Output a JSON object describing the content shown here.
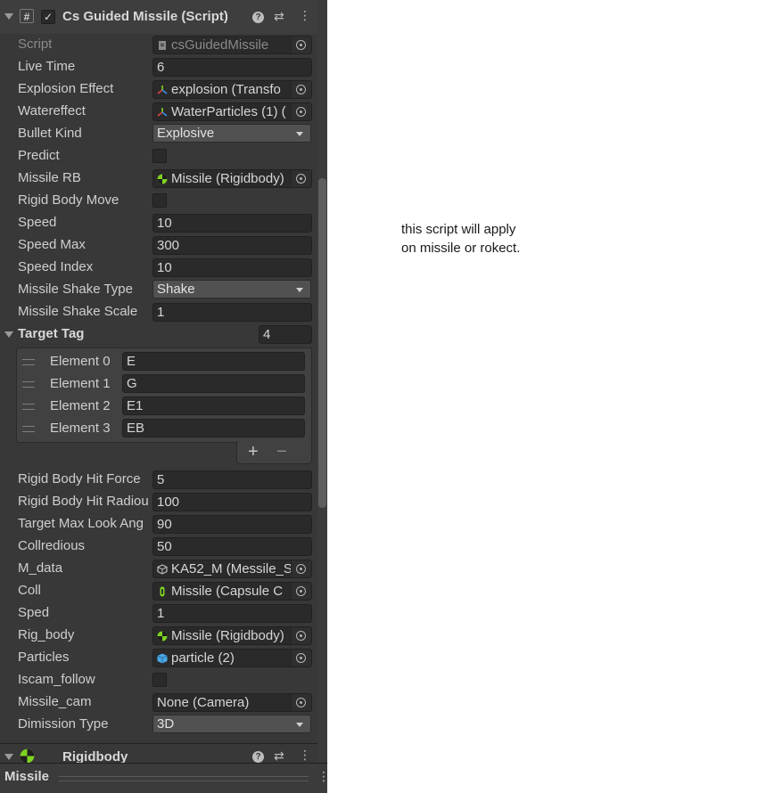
{
  "component": {
    "title": "Cs Guided Missile (Script)",
    "enabled": true
  },
  "fields": {
    "script": {
      "label": "Script",
      "value": "csGuidedMissile"
    },
    "live_time": {
      "label": "Live Time",
      "value": "6"
    },
    "explosion_effect": {
      "label": "Explosion Effect",
      "value": "explosion (Transfo"
    },
    "watereffect": {
      "label": "Watereffect",
      "value": "WaterParticles (1) ("
    },
    "bullet_kind": {
      "label": "Bullet Kind",
      "value": "Explosive"
    },
    "predict": {
      "label": "Predict",
      "checked": false
    },
    "missile_rb": {
      "label": "Missile RB",
      "value": "Missile (Rigidbody)"
    },
    "rigid_body_move": {
      "label": "Rigid Body Move",
      "checked": false
    },
    "speed": {
      "label": "Speed",
      "value": "10"
    },
    "speed_max": {
      "label": "Speed Max",
      "value": "300"
    },
    "speed_index": {
      "label": "Speed Index",
      "value": "10"
    },
    "missile_shake_type": {
      "label": "Missile Shake Type",
      "value": "Shake"
    },
    "missile_shake_scale": {
      "label": "Missile Shake Scale",
      "value": "1"
    },
    "rigid_body_hit_force": {
      "label": "Rigid Body Hit Force",
      "value": "5"
    },
    "rigid_body_hit_radius": {
      "label": "Rigid Body Hit Radiou",
      "value": "100"
    },
    "target_max_look_angle": {
      "label": "Target Max Look Ang",
      "value": "90"
    },
    "collredious": {
      "label": "Collredious",
      "value": "50"
    },
    "m_data": {
      "label": "M_data",
      "value": "KA52_M (Messile_S"
    },
    "coll": {
      "label": "Coll",
      "value": "Missile (Capsule C"
    },
    "sped": {
      "label": "Sped",
      "value": "1"
    },
    "rig_body": {
      "label": "Rig_body",
      "value": "Missile (Rigidbody)"
    },
    "particles": {
      "label": "Particles",
      "value": "particle (2)"
    },
    "iscam_follow": {
      "label": "Iscam_follow",
      "checked": false
    },
    "missile_cam": {
      "label": "Missile_cam",
      "value": "None (Camera)"
    },
    "dimission_type": {
      "label": "Dimission Type",
      "value": "3D"
    }
  },
  "target_tag": {
    "label": "Target Tag",
    "size": "4",
    "elements": [
      {
        "label": "Element 0",
        "value": "E"
      },
      {
        "label": "Element 1",
        "value": "G"
      },
      {
        "label": "Element 2",
        "value": "E1"
      },
      {
        "label": "Element 3",
        "value": "EB"
      }
    ],
    "add_label": "+",
    "remove_label": "−"
  },
  "next_component": {
    "title": "Rigidbody"
  },
  "bottom_bar": {
    "label": "Missile"
  },
  "note": {
    "text": "this script will apply\non missile or rokect."
  },
  "icons": {
    "script": "script-hash-icon",
    "help": "help-icon",
    "presets": "presets-icon",
    "menu": "kebab-menu-icon",
    "transform": "transform-icon",
    "rigidbody": "rigidbody-icon",
    "capsule_collider": "capsule-collider-icon",
    "scriptable_object": "scriptable-object-icon",
    "prefab": "prefab-cube-icon",
    "object_picker": "object-picker-icon"
  },
  "colors": {
    "panel_bg": "#383838",
    "field_bg": "#2a2a2a",
    "dropdown_bg": "#515151",
    "rigidbody_green": "#7ed321",
    "prefab_blue": "#4aa8e8"
  }
}
